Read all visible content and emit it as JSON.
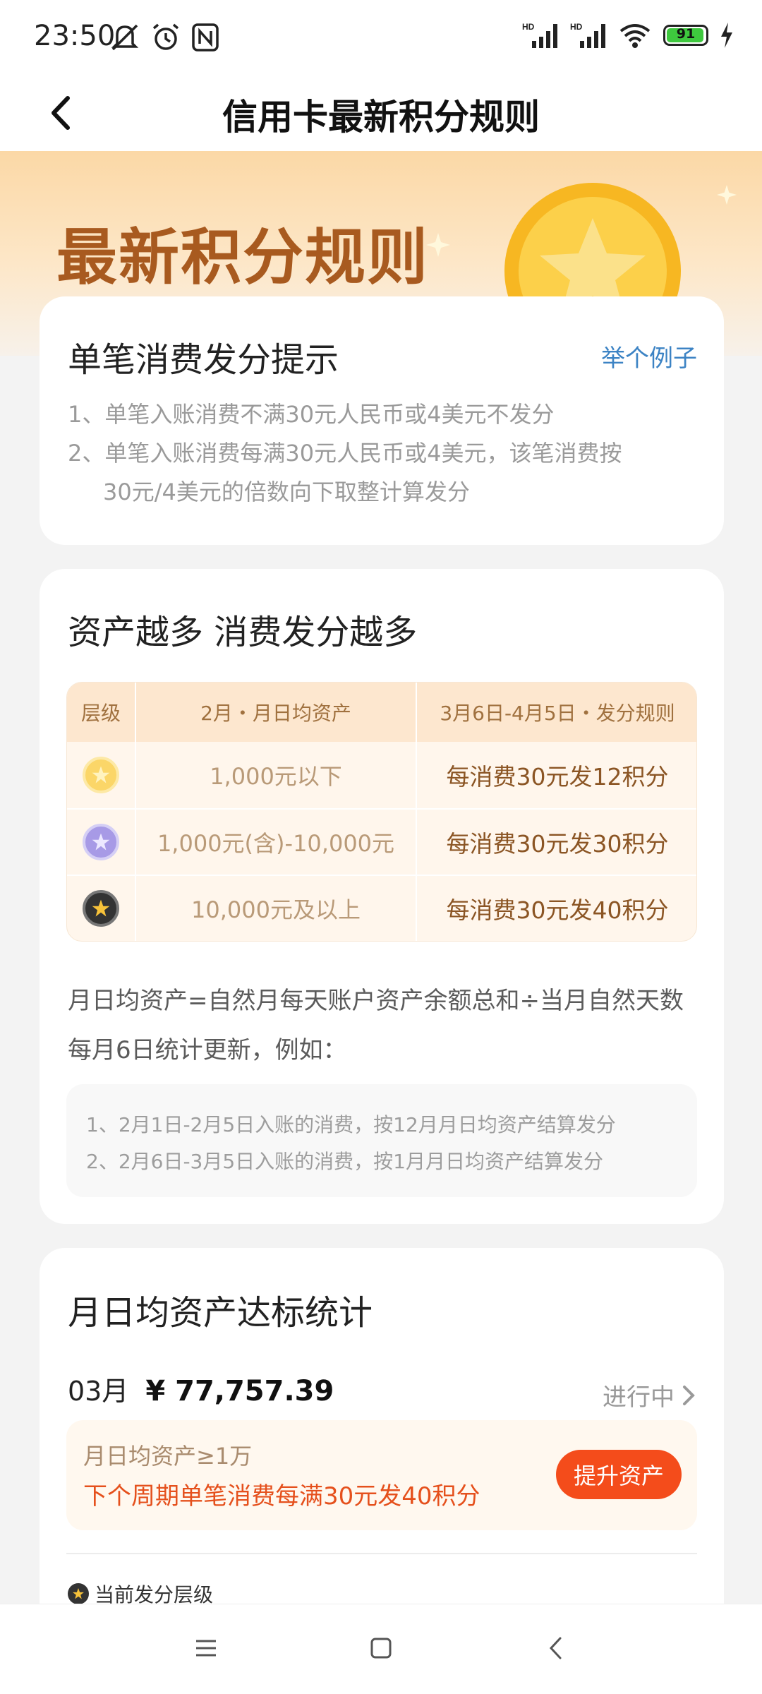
{
  "status": {
    "time": "23:50",
    "battery": "91",
    "icons": [
      "mute-icon",
      "alarm-icon",
      "nfc-icon",
      "signal-hd-icon",
      "signal-hd-icon",
      "wifi-icon",
      "battery-icon",
      "charging-icon"
    ]
  },
  "header": {
    "title": "信用卡最新积分规则"
  },
  "banner": {
    "title": "最新积分规则"
  },
  "card1": {
    "title": "单笔消费发分提示",
    "example_link": "举个例子",
    "rules": [
      "1、单笔入账消费不满30元人民币或4美元不发分",
      "2、单笔入账消费每满30元人民币或4美元，该笔消费按",
      "30元/4美元的倍数向下取整计算发分"
    ]
  },
  "card2": {
    "title": "资产越多 消费发分越多",
    "table": {
      "headers": [
        "层级",
        "2月・月日均资产",
        "3月6日-4月5日・发分规则"
      ],
      "rows": [
        {
          "level_icon": "gold-star-icon",
          "asset": "1,000元以下",
          "rule": "每消费30元发12积分"
        },
        {
          "level_icon": "purple-star-icon",
          "asset": "1,000元(含)-10,000元",
          "rule": "每消费30元发30积分"
        },
        {
          "level_icon": "black-star-icon",
          "asset": "10,000元及以上",
          "rule": "每消费30元发40积分"
        }
      ]
    },
    "desc1": "月日均资产=自然月每天账户资产余额总和÷当月自然天数",
    "desc2": "每月6日统计更新，例如：",
    "notes": [
      "1、2月1日-2月5日入账的消费，按12月月日均资产结算发分",
      "2、2月6日-3月5日入账的消费，按1月月日均资产结算发分"
    ]
  },
  "card3": {
    "title": "月日均资产达标统计",
    "month": "03月",
    "amount": "¥ 77,757.39",
    "status": "进行中",
    "promo_line1": "月日均资产≥1万",
    "promo_line2": "下个周期单笔消费每满30元发40积分",
    "promo_button": "提升资产",
    "current_level_label": "当前发分层级"
  },
  "colors": {
    "accent_orange": "#f44c1b",
    "link_blue": "#3c83c4",
    "banner_title": "#a85a1f"
  }
}
